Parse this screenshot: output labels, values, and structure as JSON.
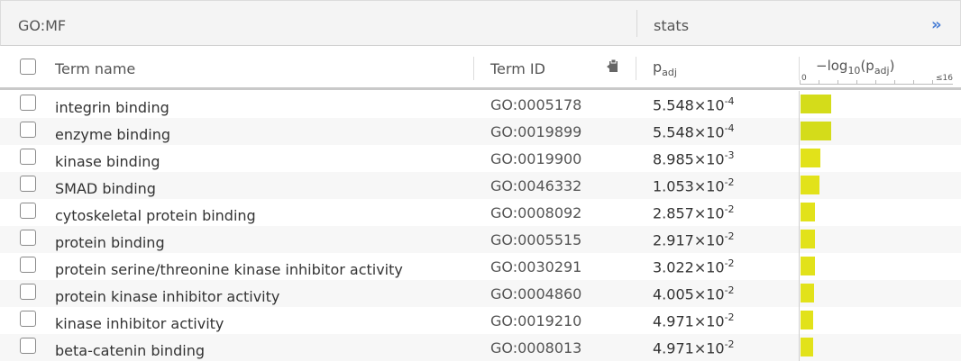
{
  "source": "GO:MF",
  "stats_label": "stats",
  "expand_icon": "»",
  "columns": {
    "term_name": "Term name",
    "term_id": "Term ID",
    "padj_main": "p",
    "padj_sub": "adj",
    "log_prefix": "−log",
    "log_base": "10",
    "log_open": "(p",
    "log_sub": "adj",
    "log_close": ")",
    "axis_min": "0",
    "axis_max": "≤16"
  },
  "colors": {
    "bar_strong": "#d4dc1a",
    "bar": "#e2e21a",
    "link": "#4a7fd6"
  },
  "rows": [
    {
      "term": "integrin binding",
      "id": "GO:0005178",
      "p_mantissa": "5.548",
      "p_exp": "-4",
      "neglog10": 3.26
    },
    {
      "term": "enzyme binding",
      "id": "GO:0019899",
      "p_mantissa": "5.548",
      "p_exp": "-4",
      "neglog10": 3.26
    },
    {
      "term": "kinase binding",
      "id": "GO:0019900",
      "p_mantissa": "8.985",
      "p_exp": "-3",
      "neglog10": 2.05
    },
    {
      "term": "SMAD binding",
      "id": "GO:0046332",
      "p_mantissa": "1.053",
      "p_exp": "-2",
      "neglog10": 1.98
    },
    {
      "term": "cytoskeletal protein binding",
      "id": "GO:0008092",
      "p_mantissa": "2.857",
      "p_exp": "-2",
      "neglog10": 1.54
    },
    {
      "term": "protein binding",
      "id": "GO:0005515",
      "p_mantissa": "2.917",
      "p_exp": "-2",
      "neglog10": 1.54
    },
    {
      "term": "protein serine/threonine kinase inhibitor activity",
      "id": "GO:0030291",
      "p_mantissa": "3.022",
      "p_exp": "-2",
      "neglog10": 1.52
    },
    {
      "term": "protein kinase inhibitor activity",
      "id": "GO:0004860",
      "p_mantissa": "4.005",
      "p_exp": "-2",
      "neglog10": 1.4
    },
    {
      "term": "kinase inhibitor activity",
      "id": "GO:0019210",
      "p_mantissa": "4.971",
      "p_exp": "-2",
      "neglog10": 1.3
    },
    {
      "term": "beta-catenin binding",
      "id": "GO:0008013",
      "p_mantissa": "4.971",
      "p_exp": "-2",
      "neglog10": 1.3
    }
  ]
}
